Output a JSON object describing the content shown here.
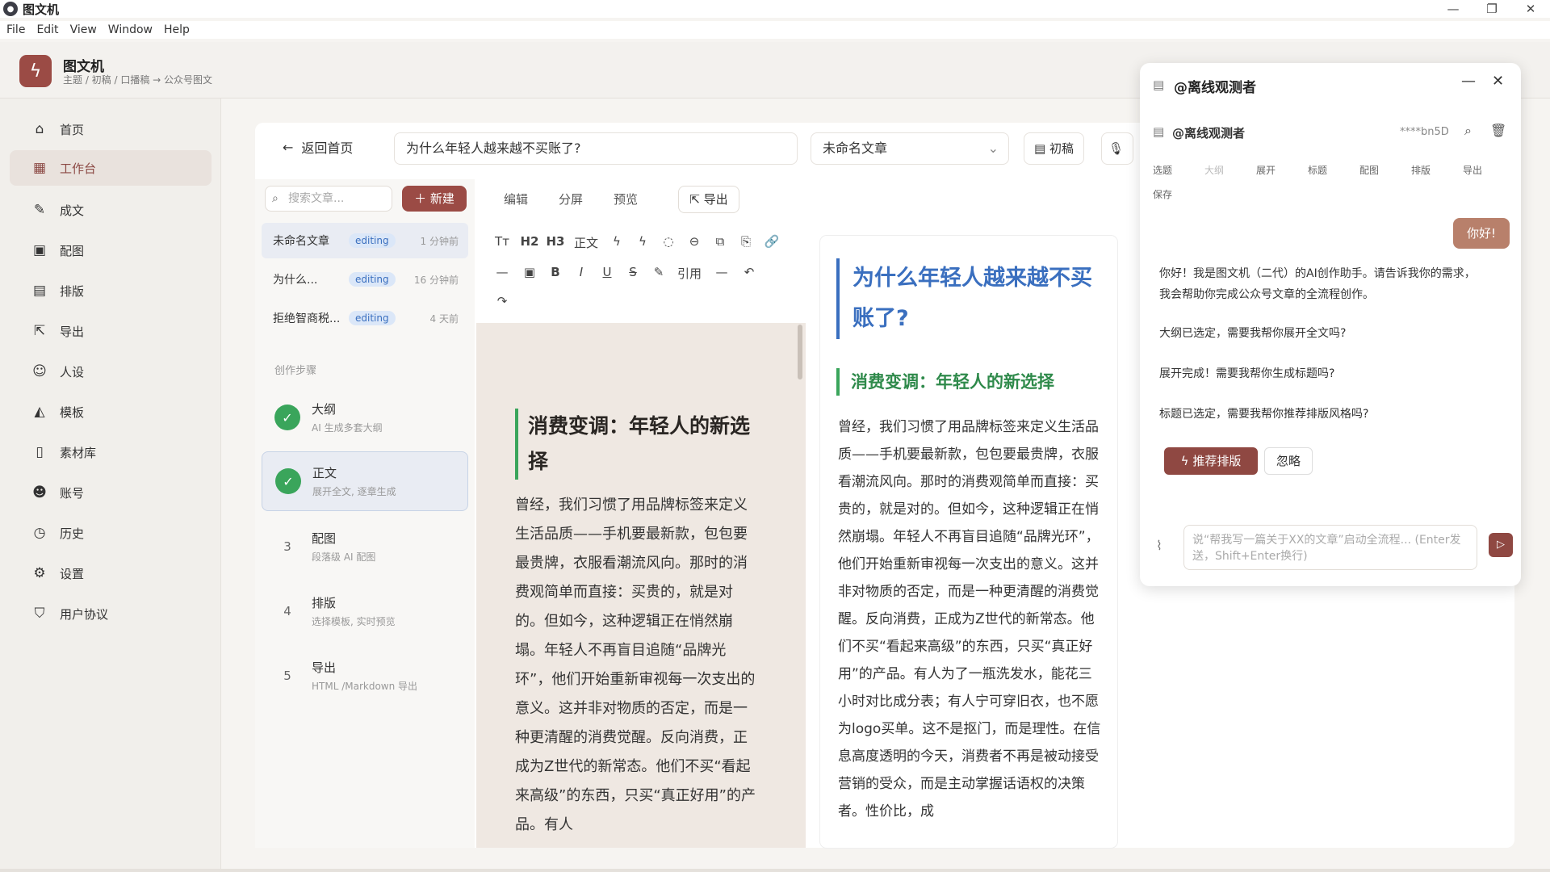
{
  "titlebar": {
    "title": "图文机",
    "logo_icon": "app-logo-icon",
    "controls": [
      "—",
      "❐",
      "✕"
    ]
  },
  "menu": [
    "File",
    "Edit",
    "View",
    "Window",
    "Help"
  ],
  "header": {
    "app_name": "图文机",
    "breadcrumb": "主题 / 初稿 / 口播稿 → 公众号图文"
  },
  "sidebar": {
    "items": [
      {
        "label": "首页",
        "icon": "home-icon"
      },
      {
        "label": "工作台",
        "icon": "grid-icon",
        "active": true
      },
      {
        "label": "成文",
        "icon": "pen-icon"
      },
      {
        "label": "配图",
        "icon": "image-icon"
      },
      {
        "label": "排版",
        "icon": "layout-icon"
      },
      {
        "label": "导出",
        "icon": "export-icon"
      },
      {
        "label": "人设",
        "icon": "user-icon"
      },
      {
        "label": "模板",
        "icon": "template-icon"
      },
      {
        "label": "素材库",
        "icon": "document-icon"
      },
      {
        "label": "账号",
        "icon": "account-icon"
      },
      {
        "label": "历史",
        "icon": "clock-icon"
      },
      {
        "label": "设置",
        "icon": "gear-icon"
      },
      {
        "label": "用户协议",
        "icon": "shield-icon"
      }
    ]
  },
  "topbar": {
    "back_label": "返回首页",
    "title_value": "为什么年轻人越来越不买账了?",
    "template_select": "未命名文章",
    "draft_label": "初稿"
  },
  "docs": {
    "search_placeholder": "搜索文章...",
    "new_label": "新建",
    "items": [
      {
        "name": "未命名文章",
        "status": "editing",
        "time": "1 分钟前"
      },
      {
        "name": "为什么...",
        "status": "editing",
        "time": "16 分钟前"
      },
      {
        "name": "拒绝智商税...",
        "status": "editing",
        "time": "4 天前"
      }
    ],
    "steps_heading": "创作步骤",
    "steps": [
      {
        "num": "",
        "title": "大纲",
        "desc": "AI 生成多套大纲",
        "done": true
      },
      {
        "num": "",
        "title": "正文",
        "desc": "展开全文, 逐章生成",
        "done": true
      },
      {
        "num": "3",
        "title": "配图",
        "desc": "段落级 AI 配图",
        "done": false
      },
      {
        "num": "4",
        "title": "排版",
        "desc": "选择模板, 实时预览",
        "done": false
      },
      {
        "num": "5",
        "title": "导出",
        "desc": "HTML /Markdown 导出",
        "done": false
      }
    ]
  },
  "editor": {
    "tabs": [
      "编辑",
      "分屏",
      "预览"
    ],
    "export_label": "导出",
    "toolbar_row1": [
      "Tт",
      "H2",
      "H3",
      "正文",
      "ϟ",
      "ϟ",
      "◌",
      "⊖",
      "⧉",
      "⎘",
      "🔗"
    ],
    "toolbar_row2": [
      "—",
      "▣",
      "B",
      "I",
      "U",
      "S",
      "✎",
      "引用",
      "—",
      "↶"
    ],
    "toolbar_row3": [
      "↷"
    ],
    "heading": "消费变调：年轻人的新选择",
    "paragraph": "曾经，我们习惯了用品牌标签来定义生活品质——手机要最新款，包包要最贵牌，衣服看潮流风向。那时的消费观简单而直接：买贵的，就是对的。但如今，这种逻辑正在悄然崩塌。年轻人不再盲目追随“品牌光环”，他们开始重新审视每一次支出的意义。这并非对物质的否定，而是一种更清醒的消费觉醒。反向消费，正成为Z世代的新常态。他们不买“看起来高级”的东西，只买“真正好用”的产品。有人"
  },
  "preview": {
    "title": "为什么年轻人越来越不买账了?",
    "heading": "消费变调：年轻人的新选择",
    "paragraph": "曾经，我们习惯了用品牌标签来定义生活品质——手机要最新款，包包要最贵牌，衣服看潮流风向。那时的消费观简单而直接：买贵的，就是对的。但如今，这种逻辑正在悄然崩塌。年轻人不再盲目追随“品牌光环”，他们开始重新审视每一次支出的意义。这并非对物质的否定，而是一种更清醒的消费觉醒。反向消费，正成为Z世代的新常态。他们不买“看起来高级”的东西，只买“真正好用”的产品。有人为了一瓶洗发水，能花三小时对比成分表；有人宁可穿旧衣，也不愿为logo买单。这不是抠门，而是理性。在信息高度透明的今天，消费者不再是被动接受营销的受众，而是主动掌握话语权的决策者。性价比，成"
  },
  "chat": {
    "window_title": "@离线观测者",
    "account_name": "@离线观测者",
    "account_id": "****bn5D",
    "tools": [
      "选题",
      "大纲",
      "展开",
      "标题",
      "配图",
      "排版",
      "导出",
      "保存"
    ],
    "user_message": "你好!",
    "assistant_messages": [
      "你好！我是图文机（二代）的AI创作助手。请告诉我你的需求，我会帮助你完成公众号文章的全流程创作。",
      "大纲已选定，需要我帮你展开全文吗?",
      "展开完成！需要我帮你生成标题吗?",
      "标题已选定，需要我帮你推荐排版风格吗?"
    ],
    "recommend_label": "推荐排版",
    "ignore_label": "忽略",
    "input_placeholder": "说“帮我写一篇关于XX的文章”启动全流程... (Enter发送，Shift+Enter换行)"
  }
}
